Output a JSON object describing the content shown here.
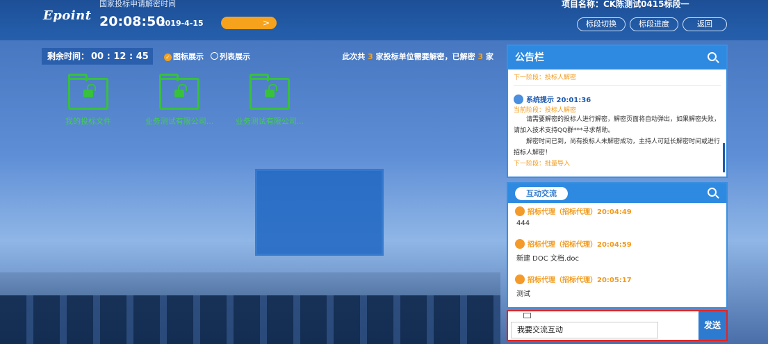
{
  "header": {
    "logo": "Epoint",
    "label": "国家投标申请解密时间",
    "time": "20:08:50",
    "date": "2019-4-15",
    "orange_button": ">",
    "project": "项目名称：CK陈测试0415标段一",
    "buttons": [
      "标段切换",
      "标段进度",
      "返回"
    ]
  },
  "toolbar": {
    "timer_label": "剩余时间：",
    "timer_value": "00 : 12 : 45",
    "view_icon": "图标展示",
    "view_list": "列表展示",
    "summary_pre": "此次共",
    "summary_total": "3",
    "summary_mid": "家投标单位需要解密，已解密",
    "summary_done": "3",
    "summary_post": "家"
  },
  "folders": [
    {
      "label": "我的投标文件"
    },
    {
      "label": "业务测试有限公司..."
    },
    {
      "label": "业务测试有限公司..."
    }
  ],
  "notice": {
    "title": "公告栏",
    "top_next": "下一阶段：投标人解密",
    "entry_title": "系统提示 20:01:36",
    "entry_stage": "当前阶段：投标人解密",
    "entry_p1": "请需要解密的投标人进行解密，解密页面将自动弹出，如果解密失败，请加入技术支持QQ群***寻求帮助。",
    "entry_p2": "解密时间已到，尚有投标人未解密成功，主持人可延长解密时间或进行招标人解密！",
    "entry_next": "下一阶段：批量导入"
  },
  "chat": {
    "tab": "互动交流",
    "messages": [
      {
        "who": "招标代理（招标代理）20:04:49",
        "text": "444"
      },
      {
        "who": "招标代理（招标代理）20:04:59",
        "text": "新建 DOC 文档.doc"
      },
      {
        "who": "招标代理（招标代理）20:05:17",
        "text": "测试"
      }
    ],
    "input_value": "我要交流互动",
    "send": "发送"
  },
  "colors": {
    "accent": "#2d8ae0",
    "orange": "#f7a21d",
    "green": "#37c13c",
    "highlight": "#e02525"
  }
}
